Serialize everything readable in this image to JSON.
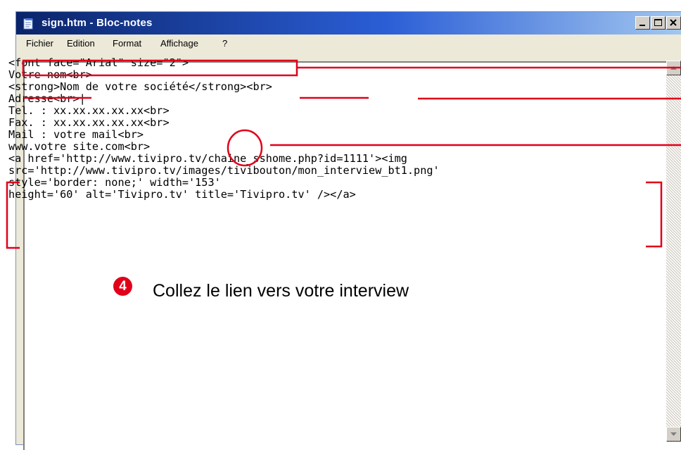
{
  "window": {
    "title": "sign.htm - Bloc-notes"
  },
  "menu": [
    {
      "label": "Fichier"
    },
    {
      "label": "Edition"
    },
    {
      "label": "Format"
    },
    {
      "label": "Affichage"
    },
    {
      "label": "?"
    }
  ],
  "editor": {
    "lines": [
      "<font face=\"Arial\" size=\"2\">",
      "Votre nom<br>",
      "<strong>Nom de votre société</strong><br>",
      "Adresse<br>|",
      "Tel. : xx.xx.xx.xx.xx<br>",
      "Fax. : xx.xx.xx.xx.xx<br>",
      "Mail : votre mail<br>",
      "www.votre site.com<br>",
      "<a href='http://www.tivipro.tv/chaine_sshome.php?id=1111'><img",
      "src='http://www.tivipro.tv/images/tivibouton/mon_interview_bt1.png'",
      "style='border: none;' width='153'",
      "height='60' alt='Tivipro.tv' title='Tivipro.tv' /></a>"
    ]
  },
  "annotation": {
    "number": "4",
    "text": "Collez le lien vers votre interview"
  },
  "colors": {
    "annotation": "#e1001a",
    "titlebar_start": "#0a246a",
    "titlebar_end": "#a6caf0"
  }
}
